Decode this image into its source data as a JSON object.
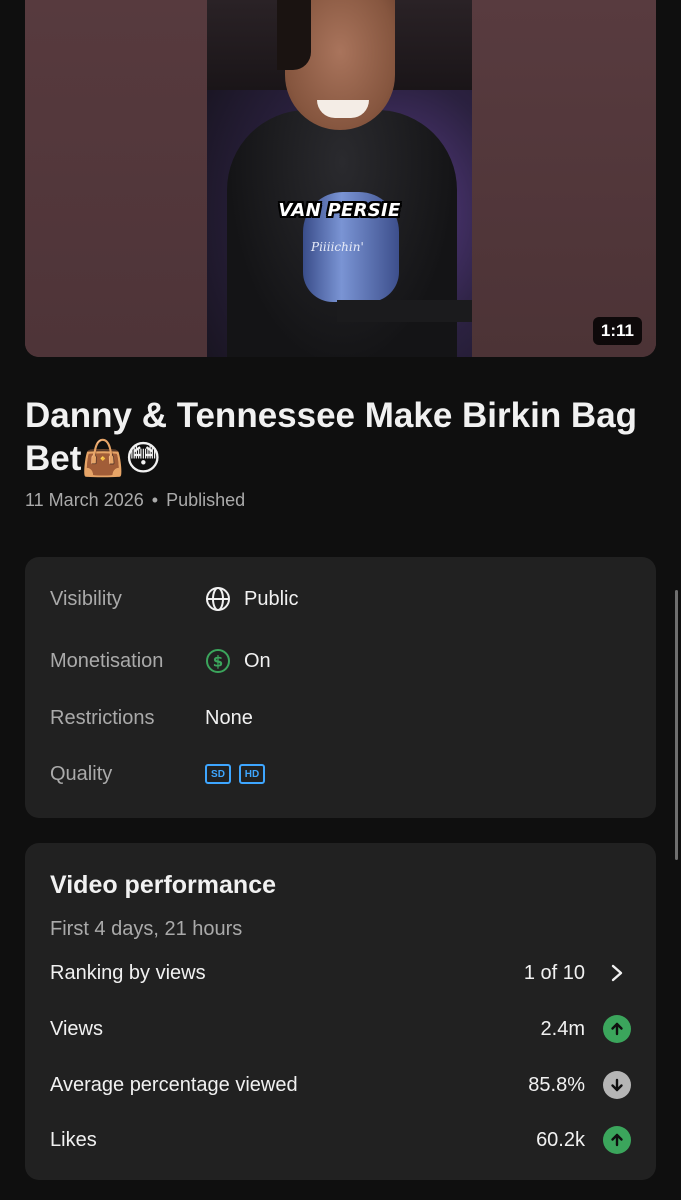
{
  "video": {
    "caption": "VAN PERSIE",
    "mic_brand": "Piiiichin'",
    "duration": "1:11"
  },
  "title": {
    "text": "Danny & Tennessee Make Birkin Bag Bet",
    "emoji": "👜😳"
  },
  "meta": {
    "date": "11 March 2026",
    "separator": "•",
    "status": "Published"
  },
  "details": {
    "visibility_label": "Visibility",
    "visibility_value": "Public",
    "monetisation_label": "Monetisation",
    "monetisation_value": "On",
    "restrictions_label": "Restrictions",
    "restrictions_value": "None",
    "quality_label": "Quality",
    "quality_badges": [
      "SD",
      "HD"
    ]
  },
  "performance": {
    "title": "Video performance",
    "subtitle": "First 4 days, 21 hours",
    "rows": [
      {
        "label": "Ranking by views",
        "value": "1 of 10",
        "indicator": "chevron-right"
      },
      {
        "label": "Views",
        "value": "2.4m",
        "indicator": "trend-up"
      },
      {
        "label": "Average percentage viewed",
        "value": "85.8%",
        "indicator": "trend-down"
      },
      {
        "label": "Likes",
        "value": "60.2k",
        "indicator": "trend-up"
      }
    ]
  },
  "colors": {
    "background": "#0f0f0f",
    "card": "#212121",
    "accent_blue": "#3ea6ff",
    "trend_up": "#3ba55c",
    "trend_down": "#b5b5b5",
    "monetisation_green": "#3ba55c"
  }
}
